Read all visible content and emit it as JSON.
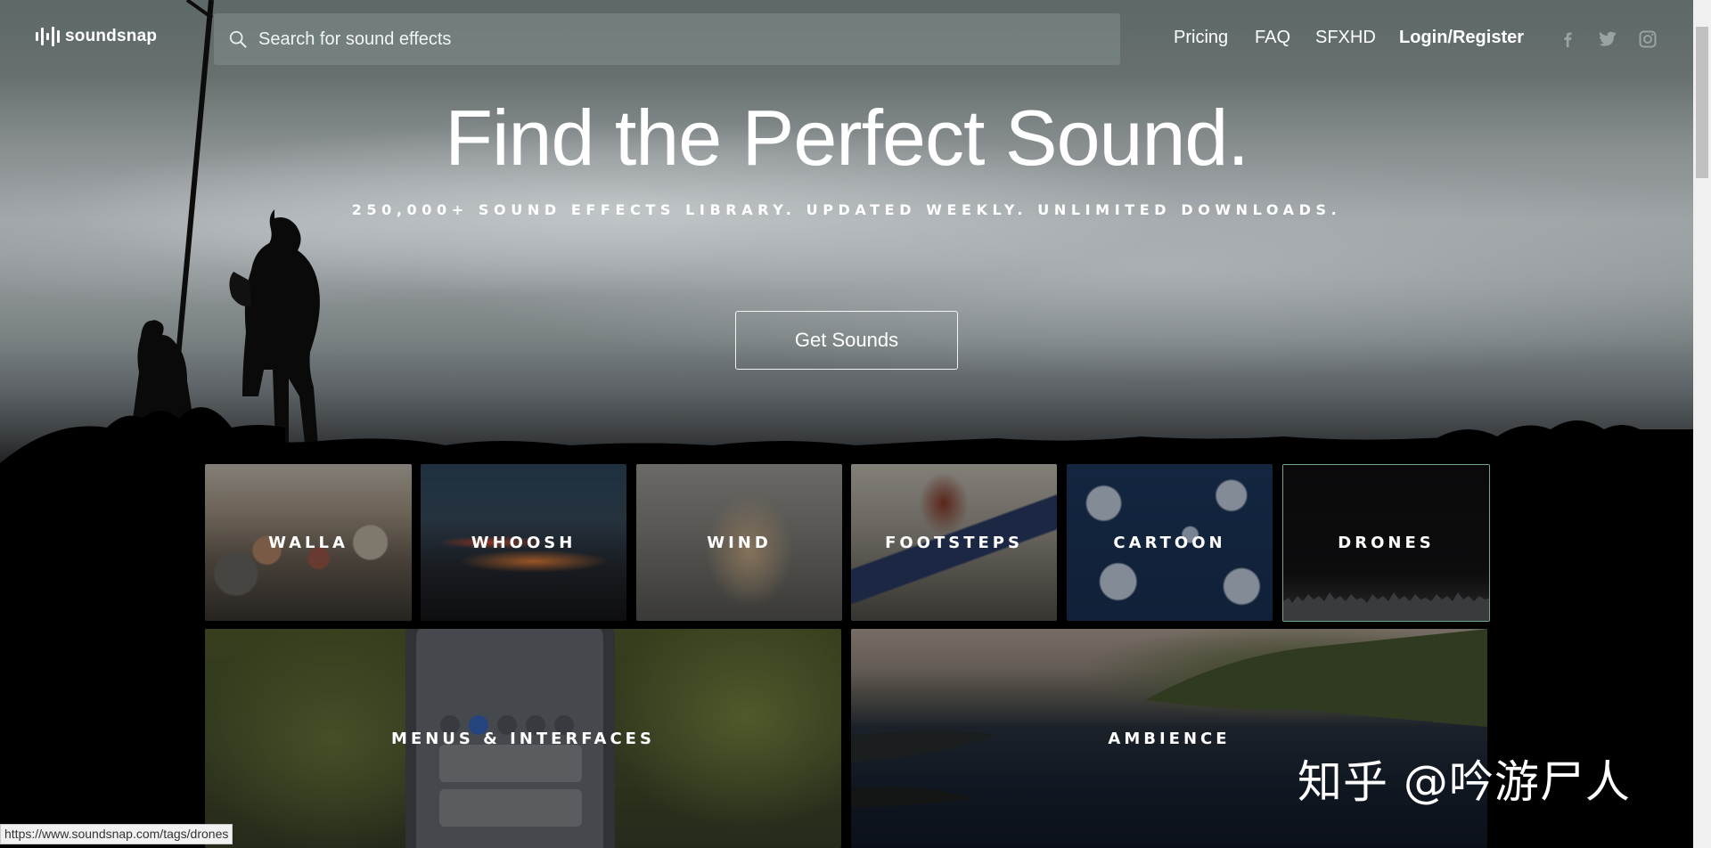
{
  "logo": {
    "text": "soundsnap"
  },
  "search": {
    "placeholder": "Search for sound effects",
    "value": ""
  },
  "nav": {
    "pricing": "Pricing",
    "faq": "FAQ",
    "sfxhd": "SFXHD",
    "login": "Login/Register"
  },
  "social": [
    "facebook-icon",
    "twitter-icon",
    "instagram-icon"
  ],
  "hero": {
    "title": "Find the Perfect Sound.",
    "subtitle": "250,000+ SOUND EFFECTS LIBRARY. UPDATED WEEKLY. UNLIMITED DOWNLOADS.",
    "cta": "Get Sounds"
  },
  "categories": [
    {
      "label": "WALLA"
    },
    {
      "label": "WHOOSH"
    },
    {
      "label": "WIND"
    },
    {
      "label": "FOOTSTEPS"
    },
    {
      "label": "CARTOON"
    },
    {
      "label": "DRONES"
    },
    {
      "label": "MENUS & INTERFACES"
    },
    {
      "label": "AMBIENCE"
    }
  ],
  "status_url": "https://www.soundsnap.com/tags/drones",
  "watermark": "知乎 @吟游尸人",
  "colors": {
    "hover_border": "#6fa88a",
    "search_bg": "#828e8e"
  }
}
